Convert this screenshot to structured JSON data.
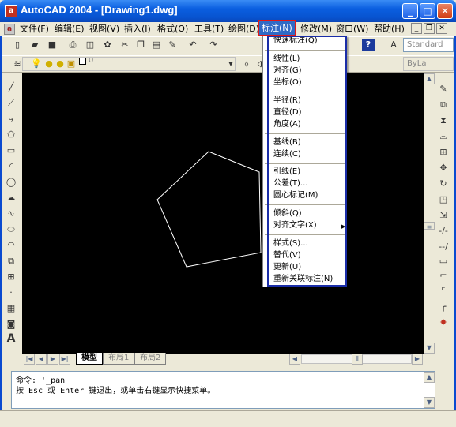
{
  "window": {
    "title": "AutoCAD 2004 - [Drawing1.dwg]",
    "app_icon_letter": "a",
    "minimize": "_",
    "maximize": "□",
    "close": "✕"
  },
  "menubar": {
    "items": [
      "文件(F)",
      "编辑(E)",
      "视图(V)",
      "插入(I)",
      "格式(O)",
      "工具(T)",
      "绘图(D)",
      "标注(N)",
      "修改(M)",
      "窗口(W)",
      "帮助(H)"
    ],
    "active": "标注(N)"
  },
  "toolbar": {
    "textstyle_value": "Standard",
    "layer_value": "0",
    "linetype_value": "ByLa"
  },
  "dimension_menu": {
    "groups": [
      [
        "快速标注(Q)"
      ],
      [
        "线性(L)",
        "对齐(G)",
        "坐标(O)"
      ],
      [
        "半径(R)",
        "直径(D)",
        "角度(A)"
      ],
      [
        "基线(B)",
        "连续(C)"
      ],
      [
        "引线(E)",
        "公差(T)...",
        "圆心标记(M)"
      ],
      [
        "倾斜(Q)",
        "对齐文字(X)"
      ],
      [
        "样式(S)...",
        "替代(V)",
        "更新(U)",
        "重新关联标注(N)"
      ]
    ],
    "submenu_arrow": "▶"
  },
  "tabs": {
    "model": "模型",
    "layout1": "布局1",
    "layout2": "布局2"
  },
  "command": {
    "line1": "命令: '_pan",
    "line2": "按 Esc 或 Enter 键退出，或单击右键显示快捷菜单。"
  },
  "left_tool_icons": [
    "line-icon",
    "ray-icon",
    "polyline-icon",
    "polygon-icon",
    "rectangle-icon",
    "arc-icon",
    "circle-icon",
    "revcloud-icon",
    "spline-icon",
    "ellipse-icon",
    "ellipse-arc-icon",
    "insert-block-icon",
    "make-block-icon",
    "point-icon",
    "hatch-icon",
    "region-icon",
    "mtext-icon"
  ],
  "right_tool_icons": [
    "erase-icon",
    "copy-icon",
    "mirror-icon",
    "offset-icon",
    "array-icon",
    "move-icon",
    "rotate-icon",
    "scale-icon",
    "stretch-icon",
    "trim-icon",
    "extend-icon",
    "break-point-icon",
    "break-icon",
    "chamfer-icon",
    "fillet-icon",
    "explode-icon"
  ]
}
